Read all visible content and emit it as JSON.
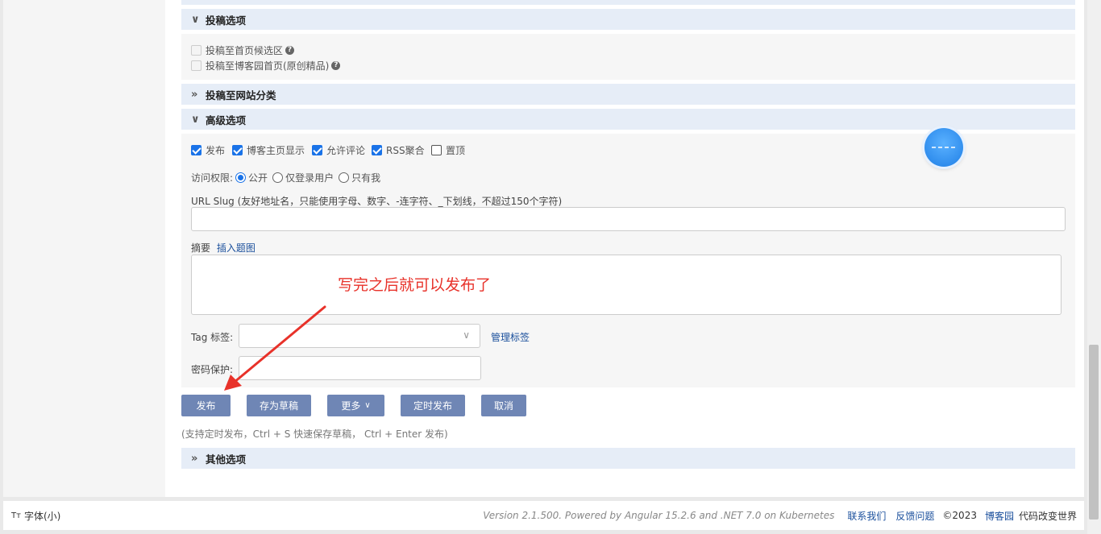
{
  "sections": {
    "submit_options": "投稿选项",
    "site_category": "投稿至网站分类",
    "advanced": "高级选项",
    "other": "其他选项"
  },
  "submit": {
    "homepage_candidate": "投稿至首页候选区",
    "homepage_original": "投稿至博客园首页(原创精品)",
    "help_glyph": "?"
  },
  "advanced": {
    "publish": "发布",
    "blog_home_show": "博客主页显示",
    "allow_comment": "允许评论",
    "rss": "RSS聚合",
    "pin_top": "置顶",
    "access_label": "访问权限:",
    "access_public": "公开",
    "access_logged_in": "仅登录用户",
    "access_only_me": "只有我",
    "slug_label": "URL Slug (友好地址名，只能使用字母、数字、-连字符、_下划线，不超过150个字符)",
    "summary_label": "摘要",
    "insert_image": "插入题图",
    "tag_label": "Tag 标签:",
    "manage_tags": "管理标签",
    "password_label": "密码保护:"
  },
  "buttons": {
    "publish": "发布",
    "save_draft": "存为草稿",
    "more": "更多",
    "schedule": "定时发布",
    "cancel": "取消"
  },
  "hint": "(支持定时发布，Ctrl + S 快速保存草稿， Ctrl + Enter 发布)",
  "annotation": "写完之后就可以发布了",
  "footer": {
    "font_icon": "Tт",
    "font_size": "字体(小)",
    "version": "Version 2.1.500. Powered by Angular 15.2.6 and .NET 7.0 on Kubernetes",
    "contact": "联系我们",
    "feedback": "反馈问题",
    "copyright": "©2023",
    "brand": "博客园",
    "slogan": "代码改变世界"
  },
  "colors": {
    "section_bg": "#e6edf7",
    "button_bg": "#6f86b5",
    "checkbox_checked": "#1a73e8",
    "annotation_red": "#e8322a",
    "link": "#1a4f9c"
  }
}
